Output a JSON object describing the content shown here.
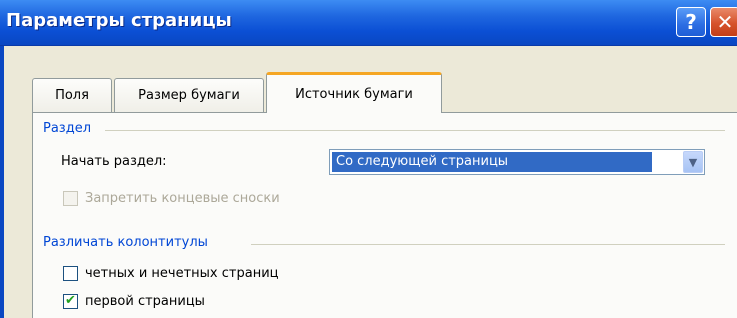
{
  "window": {
    "title": "Параметры страницы",
    "help_glyph": "?",
    "close_glyph": "✕"
  },
  "tabs": [
    {
      "label": "Поля",
      "active": false
    },
    {
      "label": "Размер бумаги",
      "active": false
    },
    {
      "label": "Источник бумаги",
      "active": true
    }
  ],
  "section": {
    "group_label": "Раздел",
    "start_label": "Начать раздел:",
    "start_value": "Со следующей страницы",
    "suppress_endnotes_label": "Запретить концевые сноски",
    "suppress_endnotes_checked": false,
    "suppress_endnotes_enabled": false
  },
  "headers_footers": {
    "group_label": "Различать колонтитулы",
    "odd_even_label": "четных и нечетных страниц",
    "odd_even_checked": false,
    "first_page_label": "первой страницы",
    "first_page_checked": true
  },
  "colors": {
    "titlebar": "#0b4fd4",
    "dialog_bg": "#ece9d8",
    "group_label": "#0046d5",
    "selection": "#316ac5",
    "active_tab_accent": "#f5a623",
    "check": "#21a121"
  }
}
